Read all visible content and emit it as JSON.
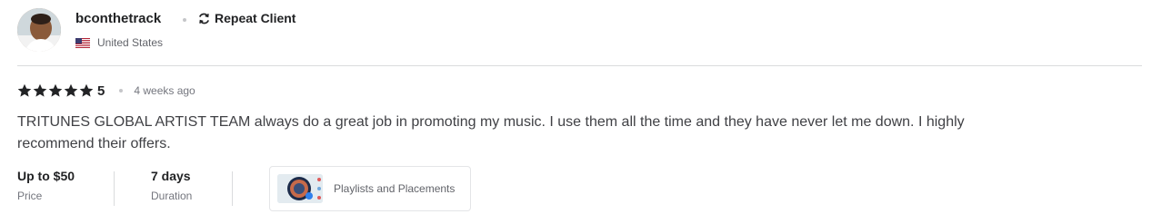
{
  "reviewer": {
    "username": "bconthetrack",
    "badge_label": "Repeat Client",
    "country": "United States"
  },
  "review": {
    "rating": "5",
    "time_ago": "4 weeks ago",
    "text": "TRITUNES GLOBAL ARTIST TEAM always do a great job in promoting my music. I use them all the time and they have never let me down. I highly recommend their offers."
  },
  "meta": {
    "price_value": "Up to $50",
    "price_label": "Price",
    "duration_value": "7 days",
    "duration_label": "Duration"
  },
  "gig": {
    "title": "Playlists and Placements"
  },
  "colors": {
    "text_primary": "#222325",
    "text_secondary": "#74767e",
    "divider": "#dadbdd"
  }
}
